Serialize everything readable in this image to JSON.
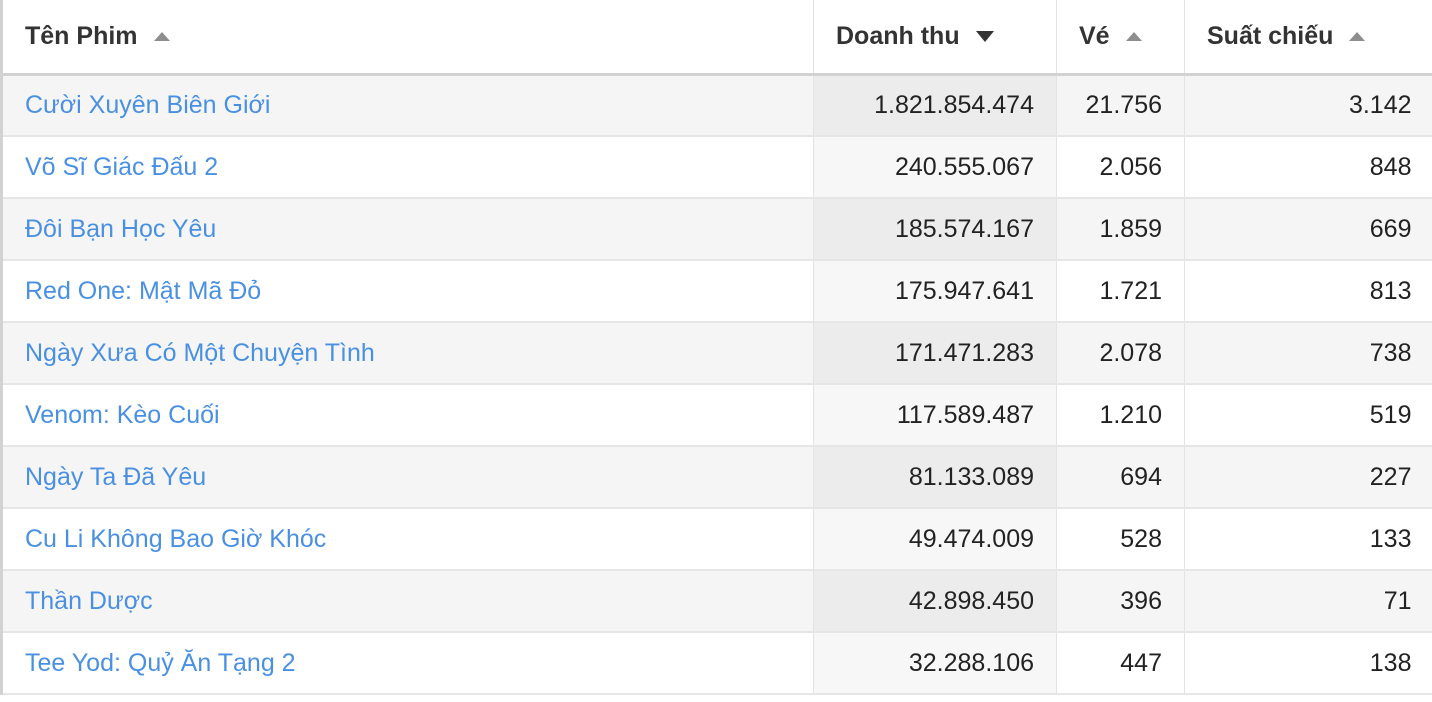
{
  "table": {
    "columns": [
      {
        "key": "title",
        "label": "Tên Phim",
        "sort": "asc",
        "active": false,
        "align": "left"
      },
      {
        "key": "revenue",
        "label": "Doanh thu",
        "sort": "desc",
        "active": true,
        "align": "right"
      },
      {
        "key": "tickets",
        "label": "Vé",
        "sort": "asc",
        "active": false,
        "align": "right"
      },
      {
        "key": "shows",
        "label": "Suất chiếu",
        "sort": "asc",
        "active": false,
        "align": "right"
      }
    ],
    "rows": [
      {
        "title": "Cười Xuyên Biên Giới",
        "revenue": "1.821.854.474",
        "tickets": "21.756",
        "shows": "3.142"
      },
      {
        "title": "Võ Sĩ Giác Đấu 2",
        "revenue": "240.555.067",
        "tickets": "2.056",
        "shows": "848"
      },
      {
        "title": "Đôi Bạn Học Yêu",
        "revenue": "185.574.167",
        "tickets": "1.859",
        "shows": "669"
      },
      {
        "title": "Red One: Mật Mã Đỏ",
        "revenue": "175.947.641",
        "tickets": "1.721",
        "shows": "813"
      },
      {
        "title": "Ngày Xưa Có Một Chuyện Tình",
        "revenue": "171.471.283",
        "tickets": "2.078",
        "shows": "738"
      },
      {
        "title": "Venom: Kèo Cuối",
        "revenue": "117.589.487",
        "tickets": "1.210",
        "shows": "519"
      },
      {
        "title": "Ngày Ta Đã Yêu",
        "revenue": "81.133.089",
        "tickets": "694",
        "shows": "227"
      },
      {
        "title": "Cu Li Không Bao Giờ Khóc",
        "revenue": "49.474.009",
        "tickets": "528",
        "shows": "133"
      },
      {
        "title": "Thần Dược",
        "revenue": "42.898.450",
        "tickets": "396",
        "shows": "71"
      },
      {
        "title": "Tee Yod: Quỷ Ăn Tạng 2",
        "revenue": "32.288.106",
        "tickets": "447",
        "shows": "138"
      }
    ],
    "icons": {
      "sort_asc": "sort-ascending-icon",
      "sort_desc": "sort-descending-icon"
    },
    "colors": {
      "link": "#4a90e2",
      "header_text": "#333333",
      "active_column_bg": "#ececec",
      "zebra_bg": "#f5f5f5",
      "border": "#e6e6e6"
    }
  }
}
